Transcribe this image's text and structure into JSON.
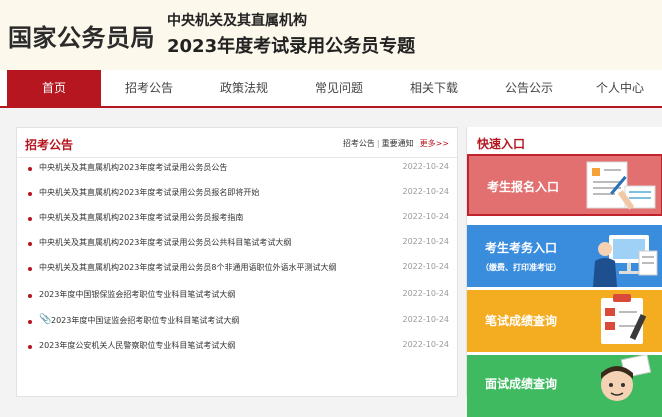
{
  "header": {
    "brand": "国家公务员局",
    "title_line1": "中央机关及其直属机构",
    "title_line2": "2023年度考试录用公务员专题"
  },
  "nav": {
    "items": [
      "首页",
      "招考公告",
      "政策法规",
      "常见问题",
      "相关下载",
      "公告公示",
      "个人中心"
    ]
  },
  "announcements": {
    "title": "招考公告",
    "link1": "招考公告",
    "link2": "重要通知",
    "more": "更多>>",
    "rows": [
      {
        "text": "中央机关及其直属机构2023年度考试录用公务员公告",
        "date": "2022-10-24"
      },
      {
        "text": "中央机关及其直属机构2023年度考试录用公务员报名即将开始",
        "date": "2022-10-24"
      },
      {
        "text": "中央机关及其直属机构2023年度考试录用公务员报考指南",
        "date": "2022-10-24"
      },
      {
        "text": "中央机关及其直属机构2023年度考试录用公务员公共科目笔试考试大纲",
        "date": "2022-10-24"
      },
      {
        "text": "中央机关及其直属机构2023年度考试录用公务员8个非通用语职位外语水平测试大纲",
        "date": "2022-10-24"
      },
      {
        "text": "2023年度中国银保监会招考职位专业科目笔试考试大纲",
        "date": "2022-10-24"
      },
      {
        "text": "2023年度中国证监会招考职位专业科目笔试考试大纲",
        "date": "2022-10-24"
      },
      {
        "text": "2023年度公安机关人民警察职位专业科目笔试考试大纲",
        "date": "2022-10-24"
      }
    ]
  },
  "quick": {
    "title": "快速入口",
    "card1": "考生报名入口",
    "card2": "考生考务入口",
    "card2_sub": "（缴费、打印准考证）",
    "card3": "笔试成绩查询",
    "card4": "面试成绩查询"
  },
  "colors": {
    "accent": "#b5161f",
    "card1": "#e37070",
    "card2": "#3a8ddd",
    "card3": "#f4ac20",
    "card4": "#3fba61"
  }
}
